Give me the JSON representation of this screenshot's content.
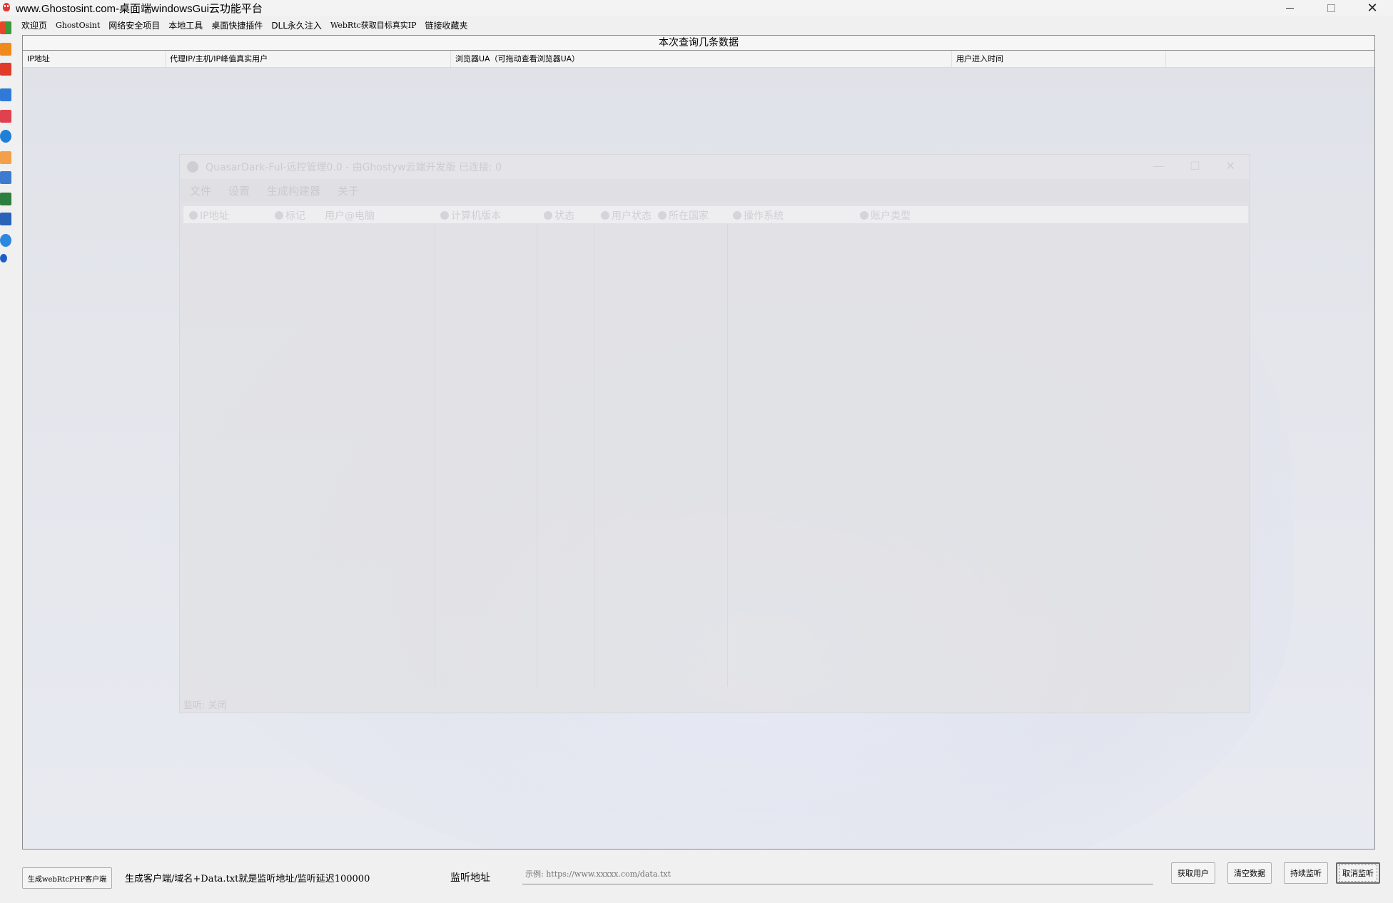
{
  "window": {
    "title": "www.Ghostosint.com-桌面端windowsGui云功能平台",
    "min_glyph": "",
    "close_glyph": "✕"
  },
  "menu": [
    "欢迎页",
    "GhostOsint",
    "网络安全项目",
    "本地工具",
    "桌面快捷插件",
    "DLL永久注入",
    "WebRtc获取目标真实IP",
    "链接收藏夹"
  ],
  "left_icons": [
    "windows-logo-icon",
    "orange-icon",
    "red-icon",
    "blue-panel-icon",
    "lock-icon",
    "ie-icon",
    "orange-doc-icon",
    "play-icon",
    "green-grid-icon",
    "blue-doc-icon",
    "ie-icon-2",
    "moon-icon"
  ],
  "panel": {
    "header": "本次查询几条数据",
    "columns": [
      "IP地址",
      "代理IP/主机/IP峰值真实用户",
      "浏览器UA（可拖动查看浏览器UA）",
      "用户进入时间",
      ""
    ]
  },
  "ghost_window": {
    "title": "QuasarDark-Ful-远控管理0.0 - 由Ghostyw云端开发版   已连接: 0",
    "menu": [
      "文件",
      "设置",
      "生成构建器",
      "关于"
    ],
    "columns": [
      "IP地址",
      "标记",
      "用户@电脑",
      "计算机版本",
      "状态",
      "用户状态",
      "所在国家",
      "操作系统",
      "账户类型"
    ],
    "status": "监听: 关闭",
    "ctrl_min": "—",
    "ctrl_max": "☐",
    "ctrl_close": "✕"
  },
  "bottom": {
    "generate_button": "生成webRtcPHP客户端",
    "hint_label": "生成客户端/域名+Data.txt就是监听地址/监听延迟100000",
    "listen_label": "监听地址",
    "listen_placeholder": "示例: https://www.xxxxx.com/data.txt",
    "get_users_button": "获取用户",
    "clear_button": "清空数据",
    "continuous_button": "持续监听",
    "cancel_button": "取消监听"
  }
}
